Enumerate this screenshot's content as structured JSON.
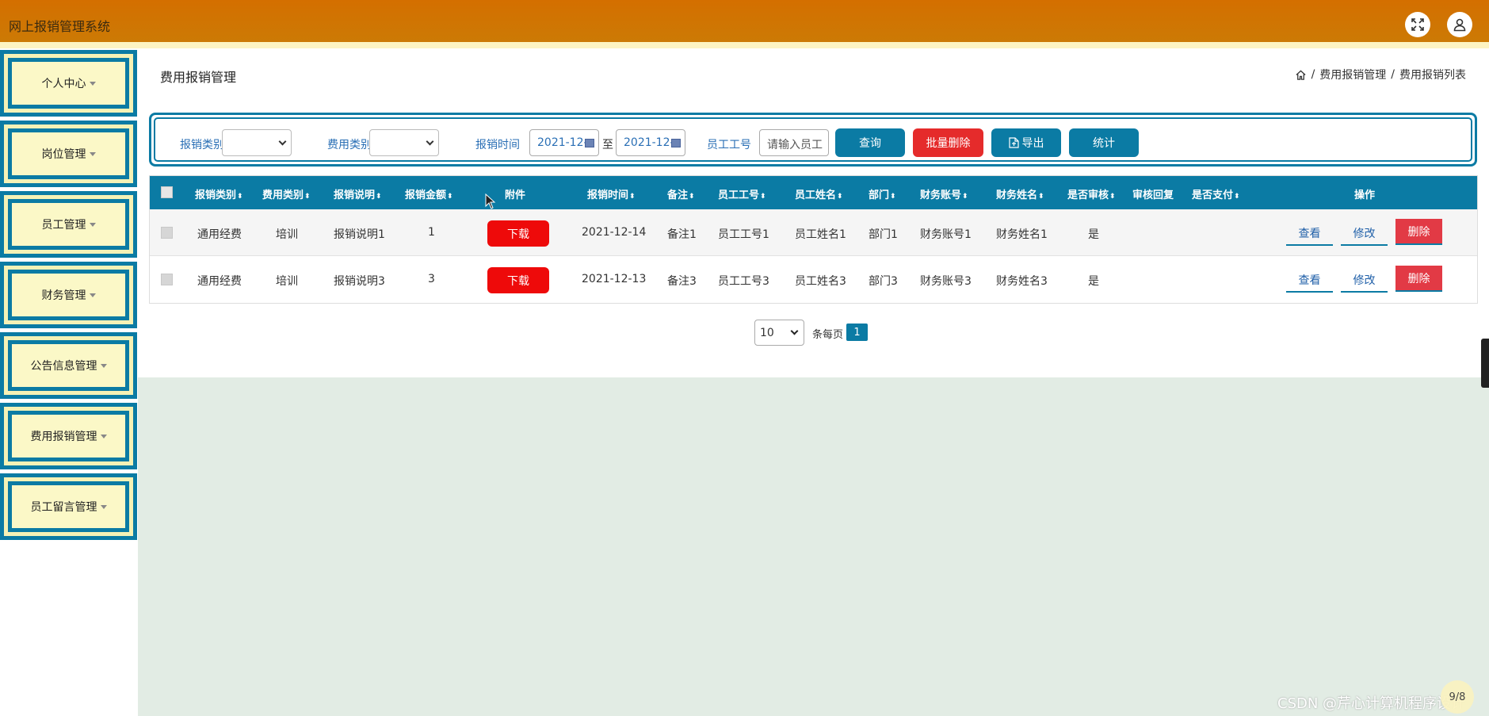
{
  "header": {
    "app_title": "网上报销管理系统",
    "icons": [
      "fullscreen-icon",
      "user-icon"
    ],
    "accent_color": "#d46f00"
  },
  "sidebar": {
    "items": [
      {
        "label": "个人中心"
      },
      {
        "label": "岗位管理"
      },
      {
        "label": "员工管理"
      },
      {
        "label": "财务管理"
      },
      {
        "label": "公告信息管理"
      },
      {
        "label": "费用报销管理"
      },
      {
        "label": "员工留言管理"
      }
    ],
    "frame_color": "#0b7ba4",
    "fill_color": "#fbf8c7"
  },
  "page": {
    "title": "费用报销管理",
    "breadcrumb": [
      "费用报销管理",
      "费用报销列表"
    ],
    "breadcrumb_separator": "/"
  },
  "search": {
    "expense_category_label": "报销类别",
    "fee_category_label": "费用类别",
    "time_label": "报销时间",
    "date_from": "2021-12-",
    "date_sep": "至",
    "date_to": "2021-12-",
    "employee_id_label": "员工工号",
    "employee_id_placeholder": "请输入员工",
    "query_button": "查询",
    "batch_delete_button": "批量删除",
    "export_button": "导出",
    "stats_button": "统计"
  },
  "table": {
    "headers": [
      "报销类别",
      "费用类别",
      "报销说明",
      "报销金额",
      "附件",
      "报销时间",
      "备注",
      "员工工号",
      "员工姓名",
      "部门",
      "财务账号",
      "财务姓名",
      "是否审核",
      "审核回复",
      "是否支付",
      "操作"
    ],
    "sort_glyph": "⬍",
    "rows": [
      {
        "type": "通用经费",
        "fee": "培训",
        "desc": "报销说明1",
        "amount": "1",
        "attachment": "下载",
        "time": "2021-12-14",
        "note": "备注1",
        "emp_id": "员工工号1",
        "emp_name": "员工姓名1",
        "dept": "部门1",
        "fin_acct": "财务账号1",
        "fin_name": "财务姓名1",
        "reviewed": "是",
        "reply": "",
        "paid": "",
        "view": "查看",
        "edit": "修改",
        "delete": "删除"
      },
      {
        "type": "通用经费",
        "fee": "培训",
        "desc": "报销说明3",
        "amount": "3",
        "attachment": "下载",
        "time": "2021-12-13",
        "note": "备注3",
        "emp_id": "员工工号3",
        "emp_name": "员工姓名3",
        "dept": "部门3",
        "fin_acct": "财务账号3",
        "fin_name": "财务姓名3",
        "reviewed": "是",
        "reply": "",
        "paid": "",
        "view": "查看",
        "edit": "修改",
        "delete": "删除"
      }
    ]
  },
  "pagination": {
    "page_size": "10",
    "per_page_label": "条每页",
    "current_page": "1"
  },
  "footer": {
    "watermark": "CSDN @芹心计算机程序设计",
    "float_label": "9/8"
  }
}
